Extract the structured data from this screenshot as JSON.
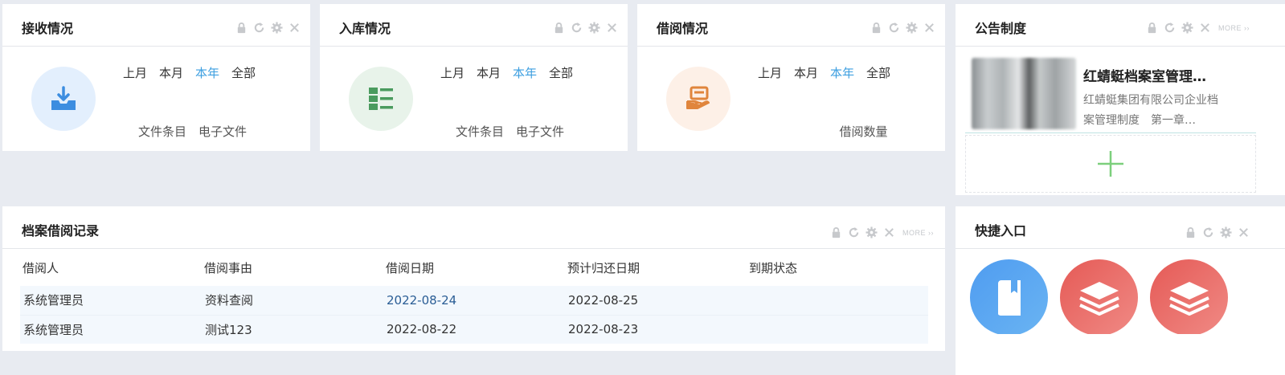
{
  "receive": {
    "title": "接收情况",
    "tabs": [
      "上月",
      "本月",
      "本年",
      "全部"
    ],
    "labels": [
      "文件条目",
      "电子文件"
    ]
  },
  "storage": {
    "title": "入库情况",
    "tabs": [
      "上月",
      "本月",
      "本年",
      "全部"
    ],
    "labels": [
      "文件条目",
      "电子文件"
    ]
  },
  "borrow": {
    "title": "借阅情况",
    "tabs": [
      "上月",
      "本月",
      "本年",
      "全部"
    ],
    "labels": [
      "借阅数量"
    ]
  },
  "notice": {
    "title": "公告制度",
    "more": "MORE",
    "item_title": "红蜻蜓档案室管理…",
    "item_desc": "红蜻蜓集团有限公司企业档案管理制度　第一章…"
  },
  "records": {
    "title": "档案借阅记录",
    "more": "MORE",
    "columns": [
      "借阅人",
      "借阅事由",
      "借阅日期",
      "预计归还日期",
      "到期状态"
    ],
    "rows": [
      [
        "系统管理员",
        "资料查阅",
        "2022-08-24",
        "2022-08-25",
        ""
      ],
      [
        "系统管理员",
        "测试123",
        "2022-08-22",
        "2022-08-23",
        ""
      ]
    ]
  },
  "shortcuts": {
    "title": "快捷入口",
    "items": [
      {
        "icon": "book-icon",
        "color": "#5aa6f0"
      },
      {
        "icon": "layers-icon",
        "color": "#e9645f"
      },
      {
        "icon": "layers-icon",
        "color": "#e9645f"
      }
    ]
  },
  "colors": {
    "active_tab": "#3d9fe0",
    "receive_icon": "#3c8de0",
    "storage_icon": "#4a9b5e",
    "borrow_icon": "#e0853c"
  }
}
